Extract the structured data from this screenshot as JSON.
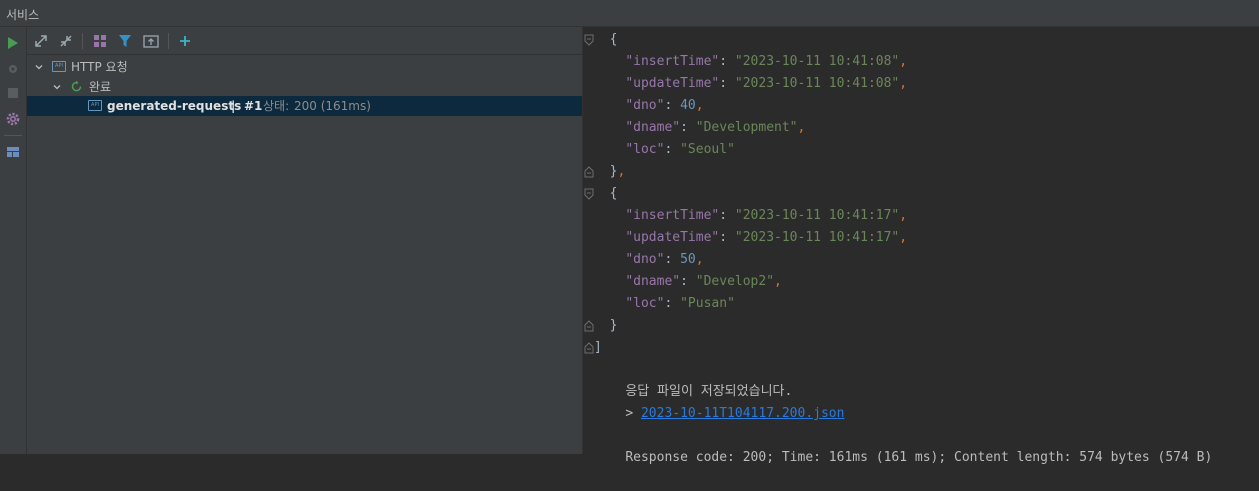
{
  "window": {
    "title": "서비스"
  },
  "colors": {
    "accent_green": "#499c54",
    "link": "#287bde",
    "selection": "#0d293e",
    "json_key": "#9876aa",
    "json_string": "#6a8759",
    "json_number": "#6897bb"
  },
  "left_strip": {
    "icons": [
      "run-icon",
      "debug-icon",
      "stop-icon",
      "settings-icon",
      "layout-icon"
    ]
  },
  "toolbar": {
    "icons": [
      "expand-all-icon",
      "collapse-all-icon",
      "group-icon",
      "filter-icon",
      "new-window-icon",
      "add-icon"
    ]
  },
  "tree": {
    "root": {
      "label": "HTTP 요청"
    },
    "group": {
      "label": "완료"
    },
    "item": {
      "name": "generated-requests",
      "separator": "|",
      "number": "#1",
      "status_label": "상태:",
      "status_value": "200 (161ms)"
    }
  },
  "response": {
    "lines": [
      {
        "indent": "  ",
        "text": "{"
      },
      {
        "indent": "    ",
        "key": "\"insertTime\"",
        "value": "\"2023-10-11 10:41:08\"",
        "type": "string",
        "comma": ","
      },
      {
        "indent": "    ",
        "key": "\"updateTime\"",
        "value": "\"2023-10-11 10:41:08\"",
        "type": "string",
        "comma": ","
      },
      {
        "indent": "    ",
        "key": "\"dno\"",
        "value": "40",
        "type": "number",
        "comma": ","
      },
      {
        "indent": "    ",
        "key": "\"dname\"",
        "value": "\"Development\"",
        "type": "string",
        "comma": ","
      },
      {
        "indent": "    ",
        "key": "\"loc\"",
        "value": "\"Seoul\"",
        "type": "string",
        "comma": ""
      },
      {
        "indent": "  ",
        "text": "}",
        "comma": ","
      },
      {
        "indent": "  ",
        "text": "{"
      },
      {
        "indent": "    ",
        "key": "\"insertTime\"",
        "value": "\"2023-10-11 10:41:17\"",
        "type": "string",
        "comma": ","
      },
      {
        "indent": "    ",
        "key": "\"updateTime\"",
        "value": "\"2023-10-11 10:41:17\"",
        "type": "string",
        "comma": ","
      },
      {
        "indent": "    ",
        "key": "\"dno\"",
        "value": "50",
        "type": "number",
        "comma": ","
      },
      {
        "indent": "    ",
        "key": "\"dname\"",
        "value": "\"Develop2\"",
        "type": "string",
        "comma": ","
      },
      {
        "indent": "    ",
        "key": "\"loc\"",
        "value": "\"Pusan\"",
        "type": "string",
        "comma": ""
      },
      {
        "indent": "  ",
        "text": "}"
      },
      {
        "indent": "",
        "text": "]"
      }
    ],
    "saved_message": "응답 파일이 저장되었습니다.",
    "file_prefix": "> ",
    "file_link": "2023-10-11T104117.200.json",
    "summary": "Response code: 200; Time: 161ms (161 ms); Content length: 574 bytes (574 B)"
  }
}
